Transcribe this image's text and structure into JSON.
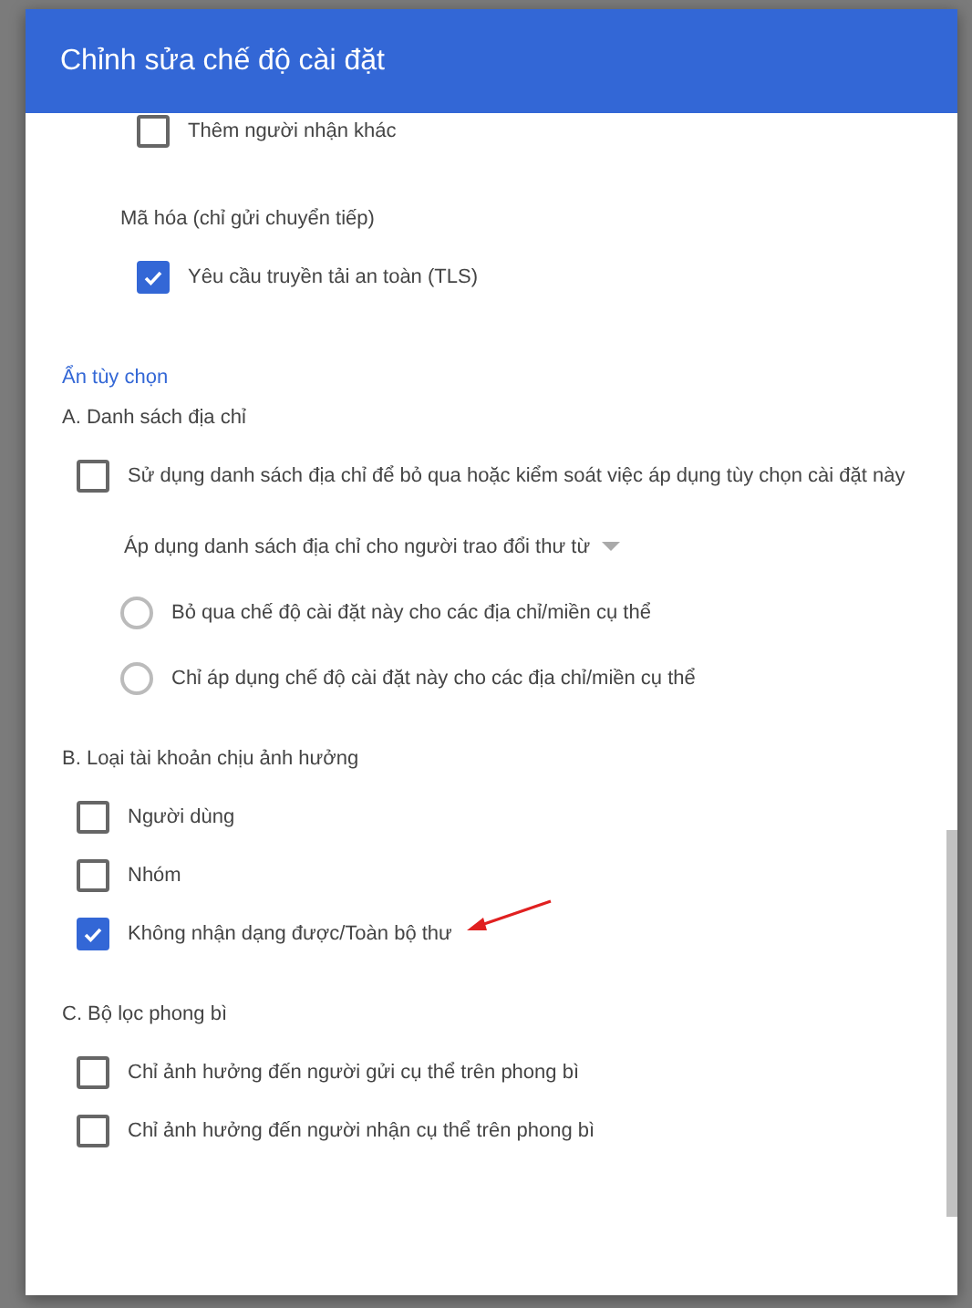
{
  "dialog": {
    "title": "Chỉnh sửa chế độ cài đặt",
    "top_group": [
      {
        "kind": "checkbox",
        "label": "Thêm người nhận khác",
        "checked": false
      },
      {
        "kind": "label",
        "label": "Mã hóa (chỉ gửi chuyển tiếp)"
      },
      {
        "kind": "checkbox",
        "label": "Yêu cầu truyền tải an toàn (TLS)",
        "checked": true
      }
    ],
    "toggle_link": "Ẩn tùy chọn",
    "sections": [
      {
        "title": "A. Danh sách địa chỉ",
        "items": [
          {
            "kind": "checkbox",
            "label": "Sử dụng danh sách địa chỉ để bỏ qua hoặc kiểm soát việc áp dụng tùy chọn cài đặt này",
            "checked": false
          },
          {
            "kind": "dropdown",
            "label": "Áp dụng danh sách địa chỉ cho người trao đổi thư từ"
          },
          {
            "kind": "radio",
            "label": "Bỏ qua chế độ cài đặt này cho các địa chỉ/miền cụ thể",
            "selected": false
          },
          {
            "kind": "radio",
            "label": "Chỉ áp dụng chế độ cài đặt này cho các địa chỉ/miền cụ thể",
            "selected": false
          }
        ]
      },
      {
        "title": "B. Loại tài khoản chịu ảnh hưởng",
        "items": [
          {
            "kind": "checkbox",
            "label": "Người dùng",
            "checked": false
          },
          {
            "kind": "checkbox",
            "label": "Nhóm",
            "checked": false
          },
          {
            "kind": "checkbox",
            "label": "Không nhận dạng được/Toàn bộ thư",
            "checked": true,
            "annotation": {
              "kind": "arrow"
            }
          }
        ]
      },
      {
        "title": "C. Bộ lọc phong bì",
        "items": [
          {
            "kind": "checkbox",
            "label": "Chỉ ảnh hưởng đến người gửi cụ thể trên phong bì",
            "checked": false
          },
          {
            "kind": "checkbox",
            "label": "Chỉ ảnh hưởng đến người nhận cụ thể trên phong bì",
            "checked": false
          }
        ]
      }
    ]
  }
}
